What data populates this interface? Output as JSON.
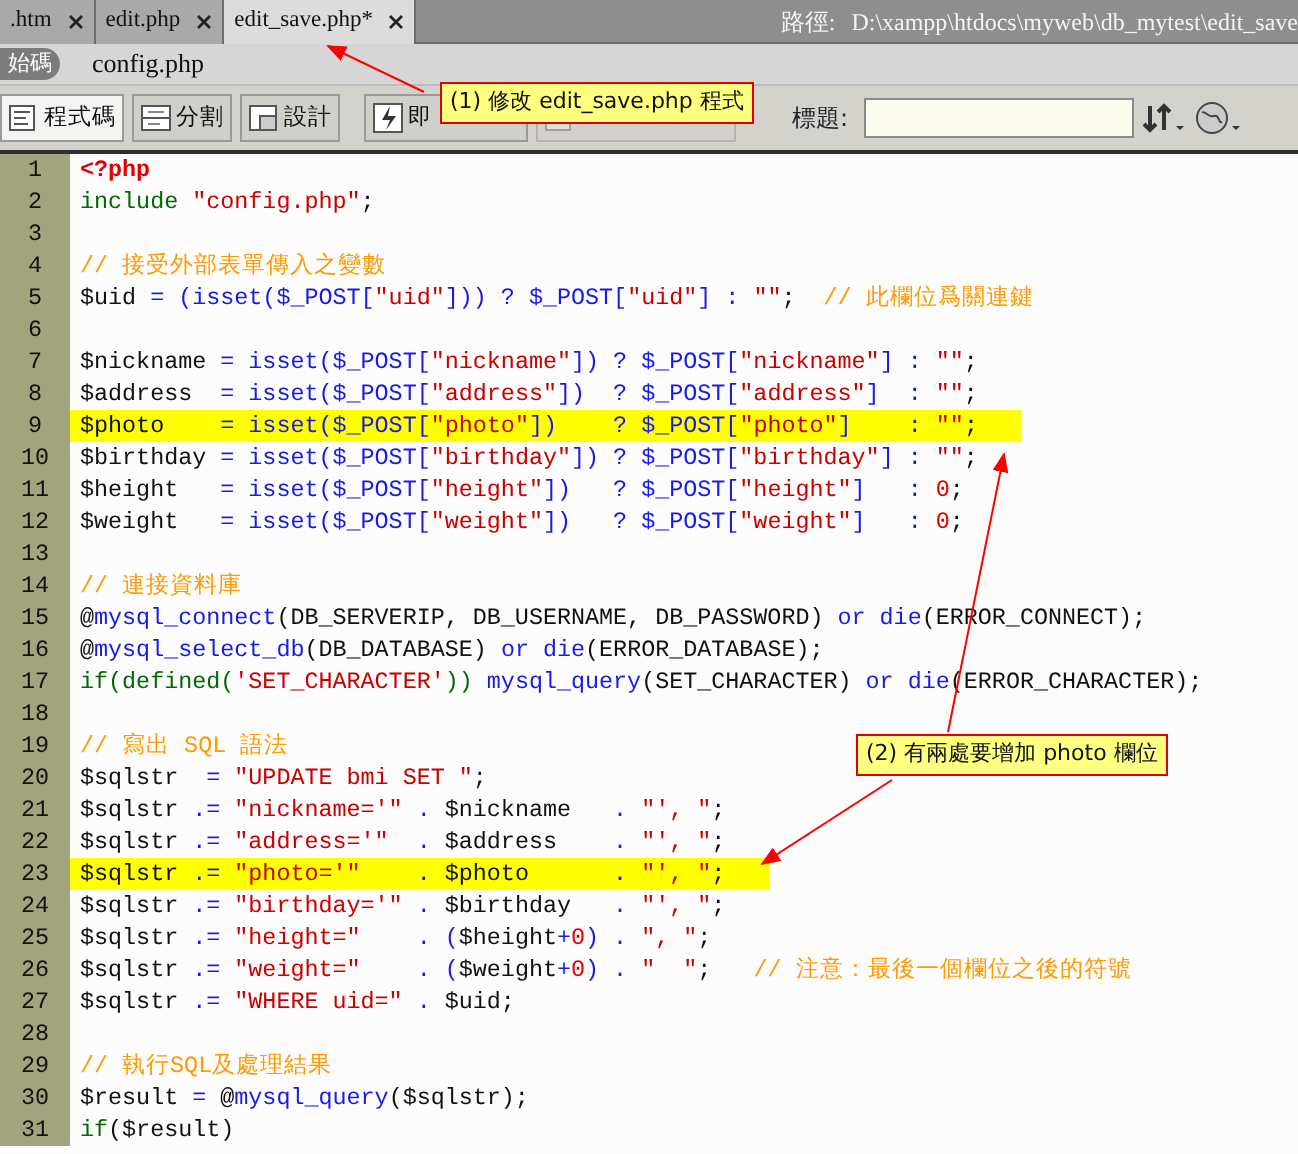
{
  "tabs": [
    {
      "label": ".htm",
      "selected": false
    },
    {
      "label": "edit.php",
      "selected": false
    },
    {
      "label": "edit_save.php*",
      "selected": true
    }
  ],
  "path": {
    "label": "路徑:",
    "value": "D:\\xampp\\htdocs\\myweb\\db_mytest\\edit_save"
  },
  "related_files": {
    "source_label": "始碼",
    "files": [
      "config.php"
    ]
  },
  "toolbar": {
    "view_buttons": [
      {
        "label": "程式碼",
        "selected": true
      },
      {
        "label": "分割",
        "selected": false
      },
      {
        "label": "設計",
        "selected": false
      }
    ],
    "live_view": {
      "label": "即"
    },
    "live_code": {
      "disabled": true
    },
    "title_label": "標題:"
  },
  "code_lines": [
    {
      "number": "1",
      "highlighted": false,
      "tokens": [
        {
          "kind": "tag",
          "text": "<?php"
        }
      ]
    },
    {
      "number": "2",
      "highlighted": false,
      "tokens": [
        {
          "kind": "kw",
          "text": "include "
        },
        {
          "kind": "str",
          "text": "\"config.php\""
        },
        {
          "kind": "tx",
          "text": ";"
        }
      ]
    },
    {
      "number": "3",
      "highlighted": false
    },
    {
      "number": "4",
      "highlighted": false,
      "tokens": [
        {
          "kind": "cm",
          "text": "// 接受外部表單傳入之變數"
        }
      ]
    },
    {
      "number": "5",
      "highlighted": false,
      "tokens": [
        {
          "kind": "tx",
          "text": "$uid "
        },
        {
          "kind": "op",
          "text": "= (isset($_POST["
        },
        {
          "kind": "str",
          "text": "\"uid\""
        },
        {
          "kind": "op",
          "text": "])) ? $_POST["
        },
        {
          "kind": "str",
          "text": "\"uid\""
        },
        {
          "kind": "op",
          "text": "] : "
        },
        {
          "kind": "str",
          "text": "\"\""
        },
        {
          "kind": "tx",
          "text": ";  "
        },
        {
          "kind": "cm",
          "text": "// 此欄位爲關連鍵"
        }
      ]
    },
    {
      "number": "6",
      "highlighted": false
    },
    {
      "number": "7",
      "highlighted": false,
      "tokens": [
        {
          "kind": "tx",
          "text": "$nickname "
        },
        {
          "kind": "op",
          "text": "= isset($_POST["
        },
        {
          "kind": "str",
          "text": "\"nickname\""
        },
        {
          "kind": "op",
          "text": "]) ? $_POST["
        },
        {
          "kind": "str",
          "text": "\"nickname\""
        },
        {
          "kind": "op",
          "text": "] : "
        },
        {
          "kind": "str",
          "text": "\"\""
        },
        {
          "kind": "tx",
          "text": ";"
        }
      ]
    },
    {
      "number": "8",
      "highlighted": false,
      "tokens": [
        {
          "kind": "tx",
          "text": "$address  "
        },
        {
          "kind": "op",
          "text": "= isset($_POST["
        },
        {
          "kind": "str",
          "text": "\"address\""
        },
        {
          "kind": "op",
          "text": "])  ? $_POST["
        },
        {
          "kind": "str",
          "text": "\"address\""
        },
        {
          "kind": "op",
          "text": "]  : "
        },
        {
          "kind": "str",
          "text": "\"\""
        },
        {
          "kind": "tx",
          "text": ";"
        }
      ]
    },
    {
      "number": "9",
      "highlighted": true,
      "tokens": [
        {
          "kind": "tx",
          "text": "$photo    "
        },
        {
          "kind": "op",
          "text": "= isset($_POST["
        },
        {
          "kind": "str",
          "text": "\"photo\""
        },
        {
          "kind": "op",
          "text": "])    ? $_POST["
        },
        {
          "kind": "str",
          "text": "\"photo\""
        },
        {
          "kind": "op",
          "text": "]    : "
        },
        {
          "kind": "str",
          "text": "\"\""
        },
        {
          "kind": "tx",
          "text": ";"
        }
      ]
    },
    {
      "number": "10",
      "highlighted": false,
      "tokens": [
        {
          "kind": "tx",
          "text": "$birthday "
        },
        {
          "kind": "op",
          "text": "= isset($_POST["
        },
        {
          "kind": "str",
          "text": "\"birthday\""
        },
        {
          "kind": "op",
          "text": "]) ? $_POST["
        },
        {
          "kind": "str",
          "text": "\"birthday\""
        },
        {
          "kind": "op",
          "text": "] : "
        },
        {
          "kind": "str",
          "text": "\"\""
        },
        {
          "kind": "tx",
          "text": ";"
        }
      ]
    },
    {
      "number": "11",
      "highlighted": false,
      "tokens": [
        {
          "kind": "tx",
          "text": "$height   "
        },
        {
          "kind": "op",
          "text": "= isset($_POST["
        },
        {
          "kind": "str",
          "text": "\"height\""
        },
        {
          "kind": "op",
          "text": "])   ? $_POST["
        },
        {
          "kind": "str",
          "text": "\"height\""
        },
        {
          "kind": "op",
          "text": "]   : "
        },
        {
          "kind": "num",
          "text": "0"
        },
        {
          "kind": "tx",
          "text": ";"
        }
      ]
    },
    {
      "number": "12",
      "highlighted": false,
      "tokens": [
        {
          "kind": "tx",
          "text": "$weight   "
        },
        {
          "kind": "op",
          "text": "= isset($_POST["
        },
        {
          "kind": "str",
          "text": "\"weight\""
        },
        {
          "kind": "op",
          "text": "])   ? $_POST["
        },
        {
          "kind": "str",
          "text": "\"weight\""
        },
        {
          "kind": "op",
          "text": "]   : "
        },
        {
          "kind": "num",
          "text": "0"
        },
        {
          "kind": "tx",
          "text": ";"
        }
      ]
    },
    {
      "number": "13",
      "highlighted": false
    },
    {
      "number": "14",
      "highlighted": false,
      "tokens": [
        {
          "kind": "cm",
          "text": "// 連接資料庫"
        }
      ]
    },
    {
      "number": "15",
      "highlighted": false,
      "tokens": [
        {
          "kind": "tx",
          "text": "@"
        },
        {
          "kind": "op",
          "text": "mysql_connect"
        },
        {
          "kind": "tx",
          "text": "(DB_SERVERIP, DB_USERNAME, DB_PASSWORD) "
        },
        {
          "kind": "op",
          "text": "or die"
        },
        {
          "kind": "tx",
          "text": "(ERROR_CONNECT);"
        }
      ]
    },
    {
      "number": "16",
      "highlighted": false,
      "tokens": [
        {
          "kind": "tx",
          "text": "@"
        },
        {
          "kind": "op",
          "text": "mysql_select_db"
        },
        {
          "kind": "tx",
          "text": "(DB_DATABASE) "
        },
        {
          "kind": "op",
          "text": "or die"
        },
        {
          "kind": "tx",
          "text": "(ERROR_DATABASE);"
        }
      ]
    },
    {
      "number": "17",
      "highlighted": false,
      "tokens": [
        {
          "kind": "kw",
          "text": "if(defined("
        },
        {
          "kind": "str",
          "text": "'SET_CHARACTER'"
        },
        {
          "kind": "kw",
          "text": "))"
        },
        {
          "kind": "op",
          "text": " mysql_query"
        },
        {
          "kind": "tx",
          "text": "(SET_CHARACTER) "
        },
        {
          "kind": "op",
          "text": "or die"
        },
        {
          "kind": "tx",
          "text": "(ERROR_CHARACTER);"
        }
      ]
    },
    {
      "number": "18",
      "highlighted": false
    },
    {
      "number": "19",
      "highlighted": false,
      "tokens": [
        {
          "kind": "cm",
          "text": "// 寫出 SQL 語法"
        }
      ]
    },
    {
      "number": "20",
      "highlighted": false,
      "tokens": [
        {
          "kind": "tx",
          "text": "$sqlstr  "
        },
        {
          "kind": "op",
          "text": "= "
        },
        {
          "kind": "str",
          "text": "\"UPDATE bmi SET \""
        },
        {
          "kind": "tx",
          "text": ";"
        }
      ]
    },
    {
      "number": "21",
      "highlighted": false,
      "tokens": [
        {
          "kind": "tx",
          "text": "$sqlstr "
        },
        {
          "kind": "op",
          "text": ".= "
        },
        {
          "kind": "str",
          "text": "\"nickname='\""
        },
        {
          "kind": "op",
          "text": " . "
        },
        {
          "kind": "tx",
          "text": "$nickname   "
        },
        {
          "kind": "op",
          "text": ". "
        },
        {
          "kind": "str",
          "text": "\"', \""
        },
        {
          "kind": "tx",
          "text": ";"
        }
      ]
    },
    {
      "number": "22",
      "highlighted": false,
      "tokens": [
        {
          "kind": "tx",
          "text": "$sqlstr "
        },
        {
          "kind": "op",
          "text": ".= "
        },
        {
          "kind": "str",
          "text": "\"address='\""
        },
        {
          "kind": "op",
          "text": "  . "
        },
        {
          "kind": "tx",
          "text": "$address    "
        },
        {
          "kind": "op",
          "text": ". "
        },
        {
          "kind": "str",
          "text": "\"', \""
        },
        {
          "kind": "tx",
          "text": ";"
        }
      ]
    },
    {
      "number": "23",
      "highlighted": true,
      "tokens": [
        {
          "kind": "tx",
          "text": "$sqlstr "
        },
        {
          "kind": "op",
          "text": ".= "
        },
        {
          "kind": "str",
          "text": "\"photo='\""
        },
        {
          "kind": "op",
          "text": "    . "
        },
        {
          "kind": "tx",
          "text": "$photo      "
        },
        {
          "kind": "op",
          "text": ". "
        },
        {
          "kind": "str",
          "text": "\"', \""
        },
        {
          "kind": "tx",
          "text": ";"
        }
      ]
    },
    {
      "number": "24",
      "highlighted": false,
      "tokens": [
        {
          "kind": "tx",
          "text": "$sqlstr "
        },
        {
          "kind": "op",
          "text": ".= "
        },
        {
          "kind": "str",
          "text": "\"birthday='\""
        },
        {
          "kind": "op",
          "text": " . "
        },
        {
          "kind": "tx",
          "text": "$birthday   "
        },
        {
          "kind": "op",
          "text": ". "
        },
        {
          "kind": "str",
          "text": "\"', \""
        },
        {
          "kind": "tx",
          "text": ";"
        }
      ]
    },
    {
      "number": "25",
      "highlighted": false,
      "tokens": [
        {
          "kind": "tx",
          "text": "$sqlstr "
        },
        {
          "kind": "op",
          "text": ".= "
        },
        {
          "kind": "str",
          "text": "\"height=\""
        },
        {
          "kind": "op",
          "text": "    . ("
        },
        {
          "kind": "tx",
          "text": "$height"
        },
        {
          "kind": "op",
          "text": "+"
        },
        {
          "kind": "num",
          "text": "0"
        },
        {
          "kind": "op",
          "text": ") . "
        },
        {
          "kind": "str",
          "text": "\", \""
        },
        {
          "kind": "tx",
          "text": ";"
        }
      ]
    },
    {
      "number": "26",
      "highlighted": false,
      "tokens": [
        {
          "kind": "tx",
          "text": "$sqlstr "
        },
        {
          "kind": "op",
          "text": ".= "
        },
        {
          "kind": "str",
          "text": "\"weight=\""
        },
        {
          "kind": "op",
          "text": "    . ("
        },
        {
          "kind": "tx",
          "text": "$weight"
        },
        {
          "kind": "op",
          "text": "+"
        },
        {
          "kind": "num",
          "text": "0"
        },
        {
          "kind": "op",
          "text": ") . "
        },
        {
          "kind": "str",
          "text": "\"  \""
        },
        {
          "kind": "tx",
          "text": ";   "
        },
        {
          "kind": "cm",
          "text": "// 注意：最後一個欄位之後的符號"
        }
      ]
    },
    {
      "number": "27",
      "highlighted": false,
      "tokens": [
        {
          "kind": "tx",
          "text": "$sqlstr "
        },
        {
          "kind": "op",
          "text": ".= "
        },
        {
          "kind": "str",
          "text": "\"WHERE uid=\""
        },
        {
          "kind": "op",
          "text": " . "
        },
        {
          "kind": "tx",
          "text": "$uid;"
        }
      ]
    },
    {
      "number": "28",
      "highlighted": false
    },
    {
      "number": "29",
      "highlighted": false,
      "tokens": [
        {
          "kind": "cm",
          "text": "// 執行SQL及處理結果"
        }
      ]
    },
    {
      "number": "30",
      "highlighted": false,
      "tokens": [
        {
          "kind": "tx",
          "text": "$result "
        },
        {
          "kind": "op",
          "text": "= "
        },
        {
          "kind": "tx",
          "text": "@"
        },
        {
          "kind": "op",
          "text": "mysql_query"
        },
        {
          "kind": "tx",
          "text": "($sqlstr);"
        }
      ]
    },
    {
      "number": "31",
      "highlighted": false,
      "tokens": [
        {
          "kind": "kw",
          "text": "if"
        },
        {
          "kind": "tx",
          "text": "($result)"
        }
      ]
    }
  ],
  "callouts": [
    {
      "text": "(1) 修改 edit_save.php  程式"
    },
    {
      "text": "(2) 有兩處要增加 photo 欄位"
    }
  ]
}
